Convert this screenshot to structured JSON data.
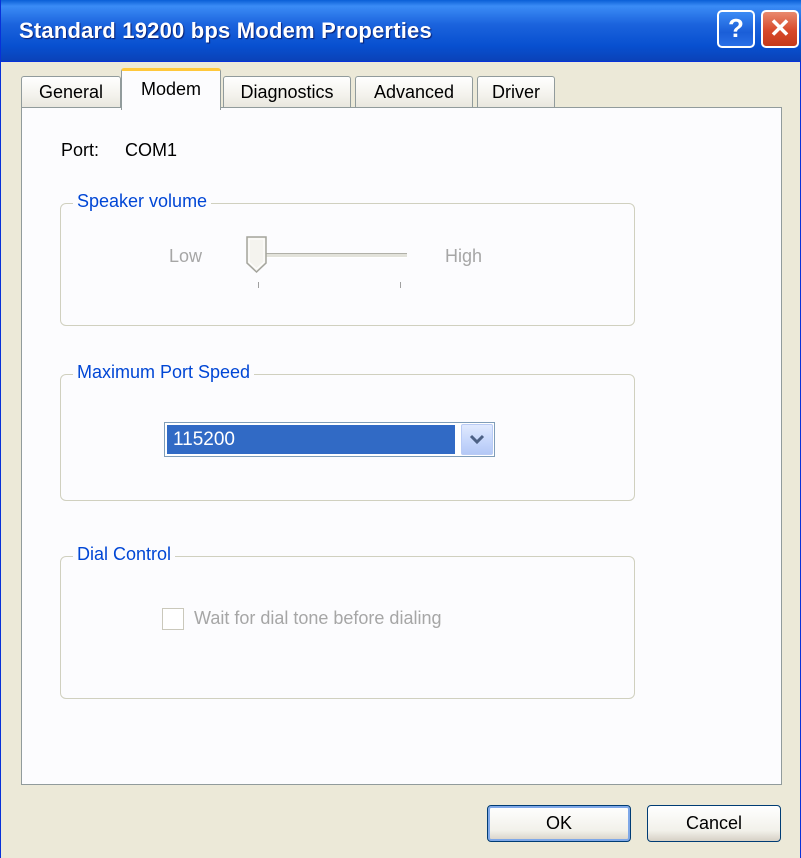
{
  "window": {
    "title": "Standard 19200 bps Modem Properties",
    "help_symbol": "?",
    "close_symbol": "✕"
  },
  "tabs": [
    {
      "label": "General"
    },
    {
      "label": "Modem",
      "active": true
    },
    {
      "label": "Diagnostics"
    },
    {
      "label": "Advanced"
    },
    {
      "label": "Driver"
    }
  ],
  "port": {
    "label": "Port:",
    "value": "COM1"
  },
  "speaker_volume": {
    "legend": "Speaker volume",
    "low_label": "Low",
    "high_label": "High",
    "level": 0,
    "enabled": false
  },
  "max_port_speed": {
    "legend": "Maximum Port Speed",
    "selected": "115200"
  },
  "dial_control": {
    "legend": "Dial Control",
    "checkbox_label": "Wait for dial tone before dialing",
    "checked": false,
    "enabled": false
  },
  "buttons": {
    "ok": "OK",
    "cancel": "Cancel"
  },
  "colors": {
    "titlebar": "#0A5FD6",
    "accent_tab": "#FFC83C",
    "selection": "#316AC5",
    "group_label": "#0046D5",
    "disabled_text": "#A6A6A6"
  },
  "icons": {
    "help": "help-icon",
    "close": "close-icon",
    "dropdown": "chevron-down-icon",
    "slider_thumb": "slider-thumb-icon"
  }
}
